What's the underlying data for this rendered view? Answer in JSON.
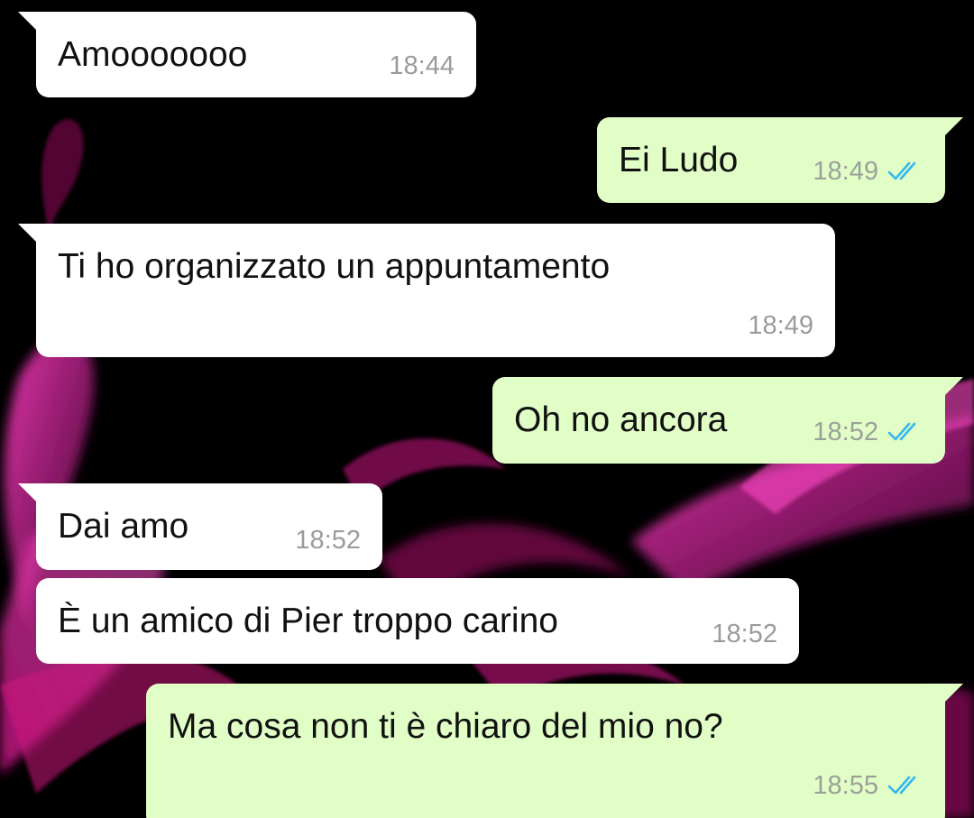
{
  "colors": {
    "incoming_bubble": "#ffffff",
    "outgoing_bubble": "#e1fec6",
    "timestamp": "#9b9b9b",
    "read_ticks": "#34b7f1",
    "wallpaper_bg": "#000000",
    "wallpaper_flame": "#e0158f"
  },
  "messages": [
    {
      "direction": "in",
      "text": "Amooooooo",
      "time": "18:44",
      "status": ""
    },
    {
      "direction": "out",
      "text": "Ei Ludo",
      "time": "18:49",
      "status": "read-double-check-icon"
    },
    {
      "direction": "in",
      "text": "Ti ho organizzato un appuntamento",
      "time": "18:49",
      "status": ""
    },
    {
      "direction": "out",
      "text": "Oh no ancora",
      "time": "18:52",
      "status": "read-double-check-icon"
    },
    {
      "direction": "in",
      "text": "Dai amo",
      "time": "18:52",
      "status": ""
    },
    {
      "direction": "in",
      "text": "È un amico di Pier troppo carino",
      "time": "18:52",
      "status": ""
    },
    {
      "direction": "out",
      "text": "Ma cosa non ti è chiaro del mio no?",
      "time": "18:55",
      "status": "read-double-check-icon"
    }
  ]
}
